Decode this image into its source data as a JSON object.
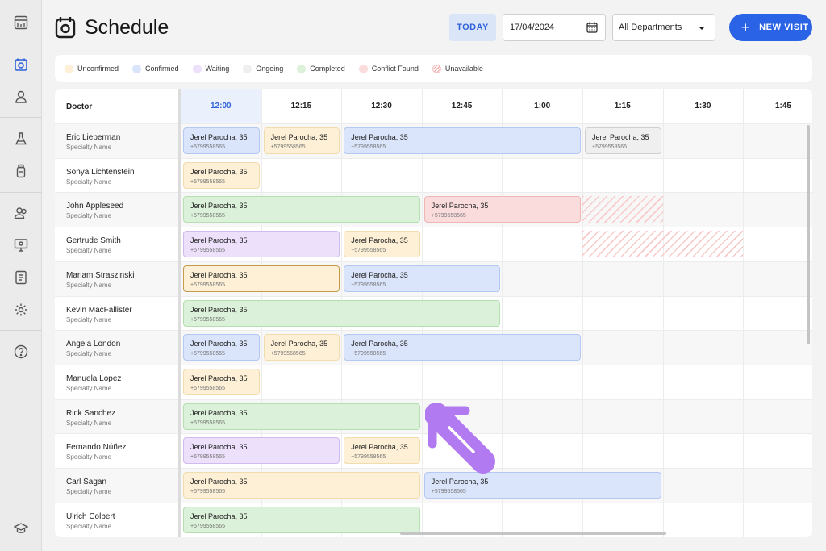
{
  "header": {
    "title": "Schedule",
    "today_label": "TODAY",
    "date_value": "17/04/2024",
    "department_value": "All Departments",
    "new_visit_label": "NEW VISIT"
  },
  "rail_icons": [
    "dashboard-icon",
    "schedule-icon",
    "user-icon",
    "lab-flask-icon",
    "medicine-bottle-icon",
    "patients-icon",
    "monitor-icon",
    "reports-icon",
    "settings-icon",
    "help-icon",
    "education-icon"
  ],
  "legend": [
    {
      "label": "Unconfirmed",
      "color": "#fdf0d6"
    },
    {
      "label": "Confirmed",
      "color": "#dae5fb"
    },
    {
      "label": "Waiting",
      "color": "#ece0fb"
    },
    {
      "label": "Ongoing",
      "color": "#efefef"
    },
    {
      "label": "Completed",
      "color": "#dbf1d9"
    },
    {
      "label": "Conflict Found",
      "color": "#fbdcdc"
    },
    {
      "label": "Unavailable",
      "color": "striped-red"
    }
  ],
  "grid": {
    "doctor_header": "Doctor",
    "current_time": "12:00",
    "times": [
      "12:00",
      "12:15",
      "12:30",
      "12:45",
      "1:00",
      "1:15",
      "1:30",
      "1:45"
    ],
    "doctors": [
      {
        "name": "Eric Lieberman",
        "specialty": "Specialty Name"
      },
      {
        "name": "Sonya Lichtenstein",
        "specialty": "Specialty Name"
      },
      {
        "name": "John Appleseed",
        "specialty": "Specialty Name"
      },
      {
        "name": "Gertrude Smith",
        "specialty": "Specialty Name"
      },
      {
        "name": "Mariam Straszinski",
        "specialty": "Specialty Name"
      },
      {
        "name": "Kevin MacFallister",
        "specialty": "Specialty Name"
      },
      {
        "name": "Angela London",
        "specialty": "Specialty Name"
      },
      {
        "name": "Manuela Lopez",
        "specialty": "Specialty Name"
      },
      {
        "name": "Rick Sanchez",
        "specialty": "Specialty Name"
      },
      {
        "name": "Fernando Núñez",
        "specialty": "Specialty Name"
      },
      {
        "name": "Carl Sagan",
        "specialty": "Specialty Name"
      },
      {
        "name": "Ulrich Colbert",
        "specialty": "Specialty Name"
      }
    ],
    "appointments": [
      {
        "row": 0,
        "start": 0,
        "span": 1,
        "status": "confirmed",
        "patient": "Jerel Parocha, 35",
        "phone": "+5799558565"
      },
      {
        "row": 0,
        "start": 1,
        "span": 1,
        "status": "unconfirmed",
        "patient": "Jerel Parocha, 35",
        "phone": "+5799558565"
      },
      {
        "row": 0,
        "start": 2,
        "span": 3,
        "status": "confirmed",
        "patient": "Jerel Parocha, 35",
        "phone": "+5799558565"
      },
      {
        "row": 0,
        "start": 5,
        "span": 1,
        "status": "ongoing",
        "patient": "Jerel Parocha, 35",
        "phone": "+5799558565"
      },
      {
        "row": 1,
        "start": 0,
        "span": 1,
        "status": "unconfirmed",
        "patient": "Jerel Parocha, 35",
        "phone": "+5799558565"
      },
      {
        "row": 2,
        "start": 0,
        "span": 3,
        "status": "completed",
        "patient": "Jerel Parocha, 35",
        "phone": "+5799558565"
      },
      {
        "row": 2,
        "start": 3,
        "span": 2,
        "status": "conflict",
        "patient": "Jerel Parocha, 35",
        "phone": "+5799558565"
      },
      {
        "row": 3,
        "start": 0,
        "span": 2,
        "status": "waiting",
        "patient": "Jerel Parocha, 35",
        "phone": "+5799558565"
      },
      {
        "row": 3,
        "start": 2,
        "span": 1,
        "status": "unconfirmed",
        "patient": "Jerel Parocha, 35",
        "phone": "+5799558565"
      },
      {
        "row": 4,
        "start": 0,
        "span": 2,
        "status": "unconfirmed",
        "selected": true,
        "patient": "Jerel Parocha, 35",
        "phone": "+5799558565"
      },
      {
        "row": 4,
        "start": 2,
        "span": 2,
        "status": "confirmed",
        "patient": "Jerel Parocha, 35",
        "phone": "+5799558565"
      },
      {
        "row": 5,
        "start": 0,
        "span": 4,
        "status": "completed",
        "patient": "Jerel Parocha, 35",
        "phone": "+5799558565"
      },
      {
        "row": 6,
        "start": 0,
        "span": 1,
        "status": "confirmed",
        "patient": "Jerel Parocha, 35",
        "phone": "+5799558565"
      },
      {
        "row": 6,
        "start": 1,
        "span": 1,
        "status": "unconfirmed",
        "patient": "Jerel Parocha, 35",
        "phone": "+5799558565"
      },
      {
        "row": 6,
        "start": 2,
        "span": 3,
        "status": "confirmed",
        "patient": "Jerel Parocha, 35",
        "phone": "+5799558565"
      },
      {
        "row": 7,
        "start": 0,
        "span": 1,
        "status": "unconfirmed",
        "patient": "Jerel Parocha, 35",
        "phone": "+5799558565"
      },
      {
        "row": 8,
        "start": 0,
        "span": 3,
        "status": "completed",
        "patient": "Jerel Parocha, 35",
        "phone": "+5799558565"
      },
      {
        "row": 9,
        "start": 0,
        "span": 2,
        "status": "waiting",
        "patient": "Jerel Parocha, 35",
        "phone": "+5799558565"
      },
      {
        "row": 9,
        "start": 2,
        "span": 1,
        "status": "unconfirmed",
        "patient": "Jerel Parocha, 35",
        "phone": "+5799558565"
      },
      {
        "row": 10,
        "start": 0,
        "span": 3,
        "status": "unconfirmed",
        "patient": "Jerel Parocha, 35",
        "phone": "+5799558565"
      },
      {
        "row": 10,
        "start": 3,
        "span": 3,
        "status": "confirmed",
        "patient": "Jerel Parocha, 35",
        "phone": "+5799558565"
      },
      {
        "row": 11,
        "start": 0,
        "span": 3,
        "status": "completed",
        "patient": "Jerel Parocha, 35",
        "phone": "+5799558565"
      }
    ],
    "unavailable": [
      {
        "row": 2,
        "start": 5,
        "span": 1
      },
      {
        "row": 3,
        "start": 5,
        "span": 2
      }
    ]
  }
}
